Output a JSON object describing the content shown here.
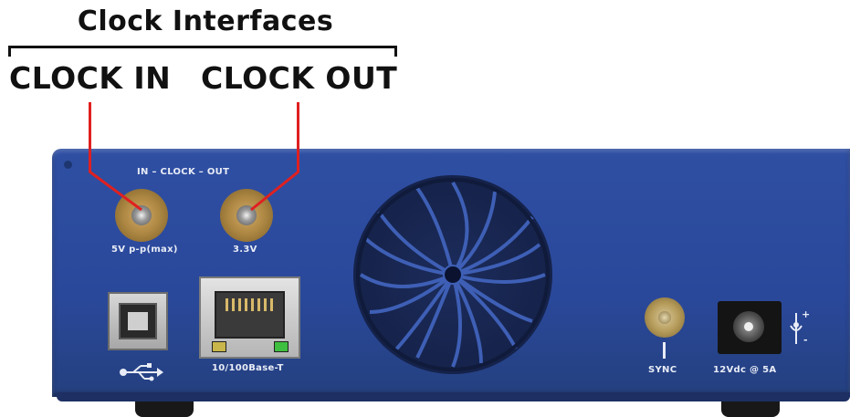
{
  "header": {
    "title": "Clock Interfaces",
    "clock_in_label": "CLOCK IN",
    "clock_out_label": "CLOCK OUT"
  },
  "panel": {
    "clock_header": "IN  –  CLOCK  –  OUT",
    "clock_in_spec": "5V p-p(max)",
    "clock_out_spec": "3.3V",
    "ethernet_label": "10/100Base-T",
    "sync_label": "SYNC",
    "power_label": "12Vdc @ 5A",
    "polarity_plus": "+",
    "polarity_minus": "-"
  },
  "colors": {
    "panel_blue": "#2a489a",
    "callout_red": "#e02020",
    "brass": "#b08a45"
  },
  "icons": [
    "usb-icon",
    "fan-icon",
    "polarity-icon"
  ]
}
